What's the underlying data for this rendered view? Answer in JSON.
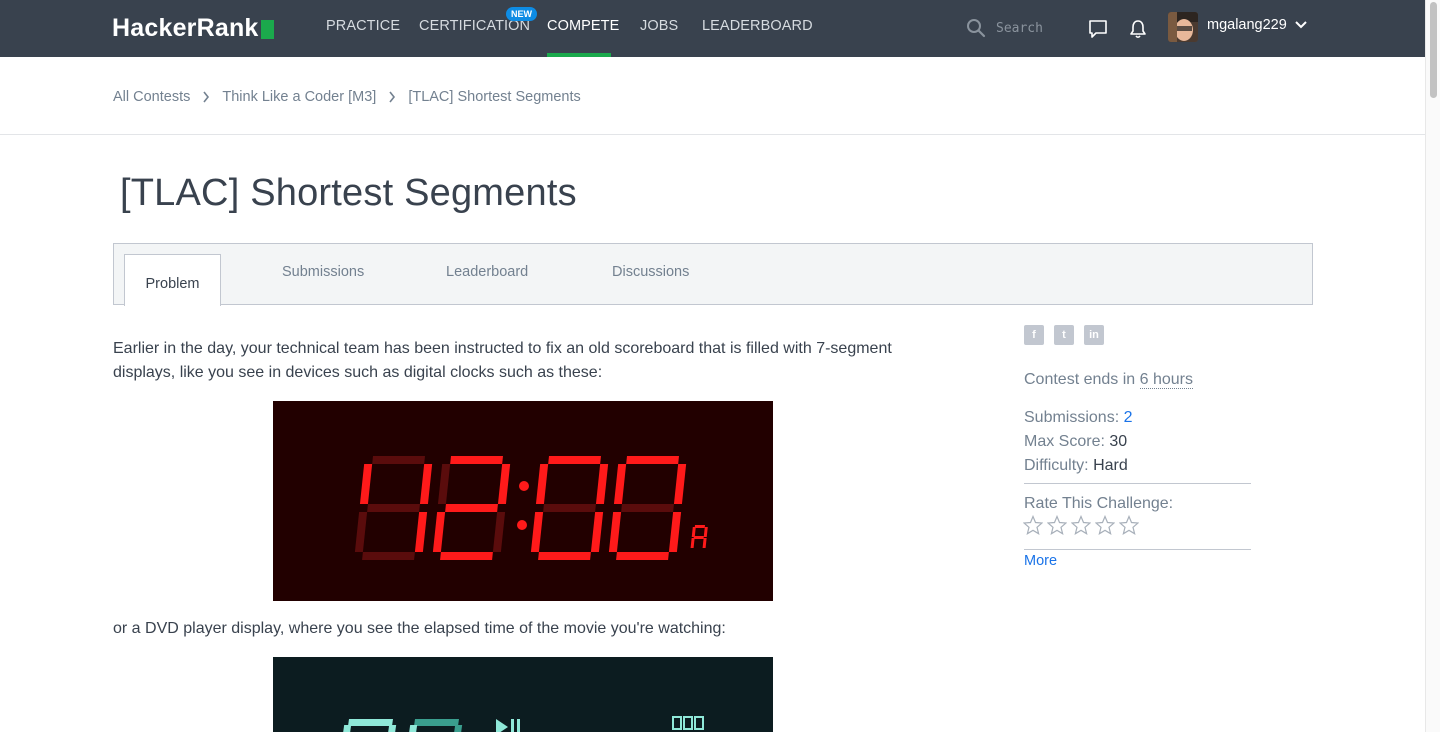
{
  "nav": {
    "logo": "HackerRank",
    "items": [
      "PRACTICE",
      "CERTIFICATION",
      "COMPETE",
      "JOBS",
      "LEADERBOARD"
    ],
    "badge_new": "NEW",
    "search_placeholder": "Search",
    "username": "mgalang229"
  },
  "breadcrumb": [
    "All Contests",
    "Think Like a Coder [M3]",
    "[TLAC] Shortest Segments"
  ],
  "title": "[TLAC] Shortest Segments",
  "tabs": [
    "Problem",
    "Submissions",
    "Leaderboard",
    "Discussions"
  ],
  "problem": {
    "paragraph1": "Earlier in the day, your technical team has been instructed to fix an old scoreboard that is filled with 7-segment displays, like you see in devices such as digital clocks such as these:",
    "paragraph2": "or a DVD player display, where you see the elapsed time of the movie you're watching:"
  },
  "sidebar": {
    "contest_ends_label": "Contest ends in",
    "contest_ends_value": "6 hours",
    "submissions_label": "Submissions:",
    "submissions_value": "2",
    "max_score_label": "Max Score:",
    "max_score_value": "30",
    "difficulty_label": "Difficulty:",
    "difficulty_value": "Hard",
    "rate_label": "Rate This Challenge:",
    "rating_stars_filled": 0,
    "rating_stars_total": 5,
    "more_label": "More",
    "social": [
      "facebook-icon",
      "twitter-icon",
      "linkedin-icon"
    ]
  },
  "colors": {
    "nav_bg": "#39424e",
    "accent_green": "#1ba94c",
    "badge_blue": "#0e8ce4",
    "link_blue": "#1a73e8",
    "segment_red": "#ff1a1a"
  }
}
